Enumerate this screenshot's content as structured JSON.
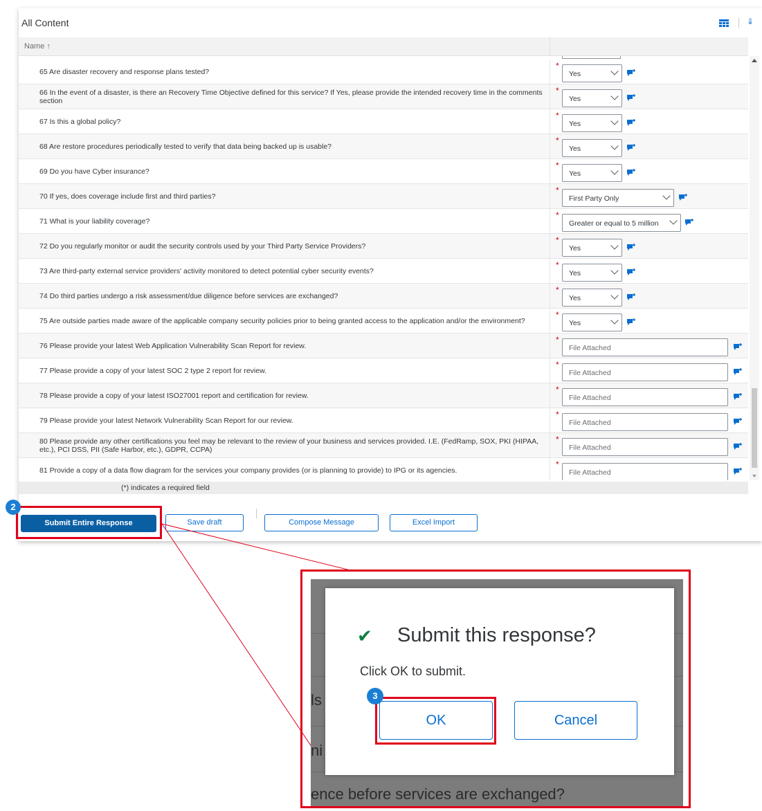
{
  "panel": {
    "title": "All Content",
    "name_column": "Name ↑"
  },
  "rows": [
    {
      "text": "65  Are disaster recovery and response plans tested?",
      "type": "select",
      "value": "Yes"
    },
    {
      "text": "66  In the event of a disaster, is there an Recovery Time Objective defined for this service? If Yes, please provide the intended recovery time in the comments section",
      "type": "select",
      "value": "Yes"
    },
    {
      "text": "67  Is this a global policy?",
      "type": "select",
      "value": "Yes"
    },
    {
      "text": "68  Are restore procedures periodically tested to verify that data being backed up is usable?",
      "type": "select",
      "value": "Yes"
    },
    {
      "text": "69  Do you have Cyber insurance?",
      "type": "select",
      "value": "Yes"
    },
    {
      "text": "70  If yes, does coverage include first and third parties?",
      "type": "select-wide",
      "value": "First Party Only"
    },
    {
      "text": "71  What is your liability coverage?",
      "type": "select-wider",
      "value": "Greater or equal to 5 million"
    },
    {
      "text": "72  Do you regularly monitor or audit the security controls used by your Third Party Service Providers?",
      "type": "select",
      "value": "Yes"
    },
    {
      "text": "73  Are third-party external service providers' activity monitored to detect potential cyber security events?",
      "type": "select",
      "value": "Yes"
    },
    {
      "text": "74  Do third parties undergo a risk assessment/due diligence before services are exchanged?",
      "type": "select",
      "value": "Yes"
    },
    {
      "text": "75  Are outside parties made aware of the applicable company security policies prior to being granted access to the application and/or the environment?",
      "type": "select",
      "value": "Yes"
    },
    {
      "text": "76  Please provide your latest Web Application Vulnerability Scan Report for review.",
      "type": "file",
      "value": "File Attached"
    },
    {
      "text": "77  Please provide a copy of  your latest  SOC 2 type 2 report for review.",
      "type": "file",
      "value": "File Attached"
    },
    {
      "text": "78  Please provide a copy of your latest ISO27001  report and certification for review.",
      "type": "file",
      "value": "File Attached"
    },
    {
      "text": "79  Please provide your latest Network Vulnerability Scan Report for our review.",
      "type": "file",
      "value": "File Attached"
    },
    {
      "text": "80  Please provide any other certifications you feel may be relevant to the review of your business and services provided.  I.E. (FedRamp, SOX, PKI (HIPAA, etc.), PCI DSS, PII (Safe Harbor, etc.), GDPR, CCPA)",
      "type": "file",
      "value": "File Attached"
    },
    {
      "text": "81  Provide a copy of a data flow diagram for the services your company provides (or is planning to provide) to IPG or its agencies.",
      "type": "file",
      "value": "File Attached"
    }
  ],
  "required_mark": "*",
  "footnote": "(*) indicates a required field",
  "actions": {
    "submit": "Submit Entire Response",
    "save_draft": "Save draft",
    "compose": "Compose Message",
    "excel_import": "Excel Import"
  },
  "badges": {
    "step2": "2",
    "step3": "3"
  },
  "dialog": {
    "title": "Submit this response?",
    "message": "Click OK to submit.",
    "ok": "OK",
    "cancel": "Cancel",
    "background_text": [
      "ls",
      "ni",
      "ence before services are exchanged?"
    ]
  },
  "colors": {
    "accent": "#0a6ed1",
    "primary_button": "#0a5fa3",
    "highlight": "#e0001b",
    "badge": "#1a7fd4",
    "check": "#107e3e",
    "required": "#d0021b"
  },
  "icons": {
    "grid": "table-grid-icon",
    "collapse": "double-chevron-down-icon",
    "comment": "comment-add-icon",
    "dropdown": "chevron-down-icon"
  }
}
